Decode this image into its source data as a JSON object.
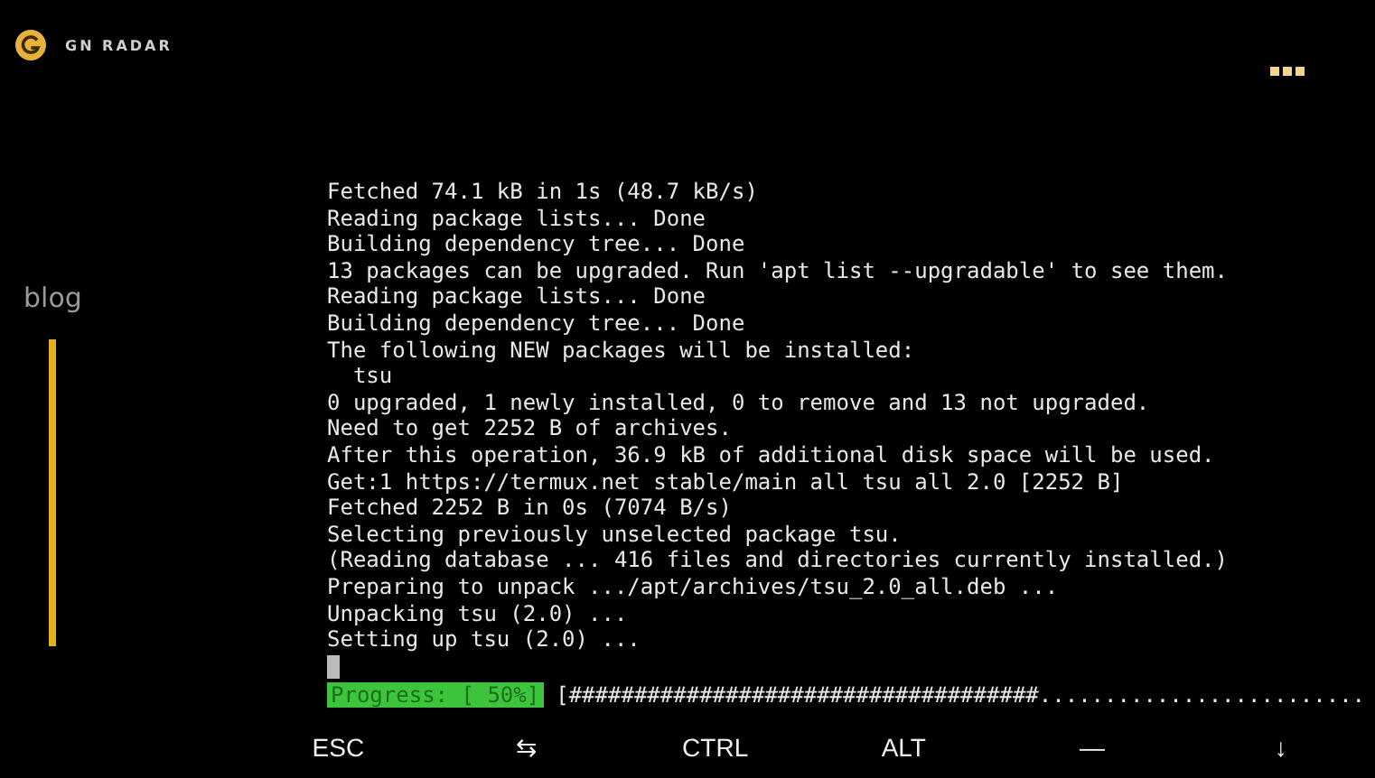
{
  "header": {
    "title": "GN RADAR"
  },
  "sidebar": {
    "label": "blog"
  },
  "terminal": {
    "lines": [
      "Fetched 74.1 kB in 1s (48.7 kB/s)",
      "Reading package lists... Done",
      "Building dependency tree... Done",
      "13 packages can be upgraded. Run 'apt list --upgradable' to see them.",
      "Reading package lists... Done",
      "Building dependency tree... Done",
      "The following NEW packages will be installed:",
      "  tsu",
      "0 upgraded, 1 newly installed, 0 to remove and 13 not upgraded.",
      "Need to get 2252 B of archives.",
      "After this operation, 36.9 kB of additional disk space will be used.",
      "Get:1 https://termux.net stable/main all tsu all 2.0 [2252 B]",
      "Fetched 2252 B in 0s (7074 B/s)",
      "Selecting previously unselected package tsu.",
      "(Reading database ... 416 files and directories currently installed.)",
      "Preparing to unpack .../apt/archives/tsu_2.0_all.deb ...",
      "Unpacking tsu (2.0) ...",
      "Setting up tsu (2.0) ..."
    ],
    "progress": {
      "label": "Progress: [ 50%]",
      "bar": "[####################################........................."
    }
  },
  "keys": [
    "ESC",
    "⇆",
    "CTRL",
    "ALT",
    "—",
    "↓"
  ]
}
